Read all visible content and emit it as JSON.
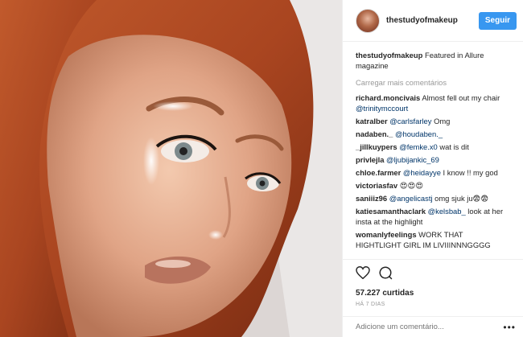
{
  "header": {
    "username": "thestudyofmakeup",
    "follow_label": "Seguir"
  },
  "caption": {
    "user": "thestudyofmakeup",
    "text": " Featured in Allure magazine"
  },
  "load_more": "Carregar mais comentários",
  "comments": [
    {
      "user": "richard.moncivais",
      "text": " Almost fell out my chair ",
      "mention": "@trinitymccourt"
    },
    {
      "user": "katralber",
      "text": " ",
      "mention": "@carlsfarley",
      "after": " Omg"
    },
    {
      "user": "nadaben._",
      "text": " ",
      "mention": "@houdaben._"
    },
    {
      "user": "_jillkuypers",
      "text": " ",
      "mention": "@femke.x0",
      "after": " wat is dit"
    },
    {
      "user": "privlejla",
      "text": " ",
      "mention": "@ljubijankic_69"
    },
    {
      "user": "chloe.farmer",
      "text": " ",
      "mention": "@heidayye",
      "after": " I know !! my god"
    },
    {
      "user": "victoriasfav",
      "text": " 😍😍😍"
    },
    {
      "user": "saniiiz96",
      "text": " ",
      "mention": "@angelicastj",
      "after": " omg sjuk ju😨😨"
    },
    {
      "user": "katiesamanthaclark",
      "text": " ",
      "mention": "@kelsbab_",
      "after": " look at her insta at the highlight"
    },
    {
      "user": "womanlyfeelings",
      "text": " WORK THAT HIGHTLIGHT GIRL IM LIVIIINNNGGGG"
    }
  ],
  "likes": "57.227 curtidas",
  "time_ago": "HÁ 7 DIAS",
  "add_comment_placeholder": "Adicione um comentário...",
  "more_label": "•••",
  "colors": {
    "accent": "#3897f0",
    "mention": "#003569",
    "muted": "#999999"
  },
  "icons": [
    "heart-icon",
    "comment-icon",
    "more-options-icon"
  ]
}
